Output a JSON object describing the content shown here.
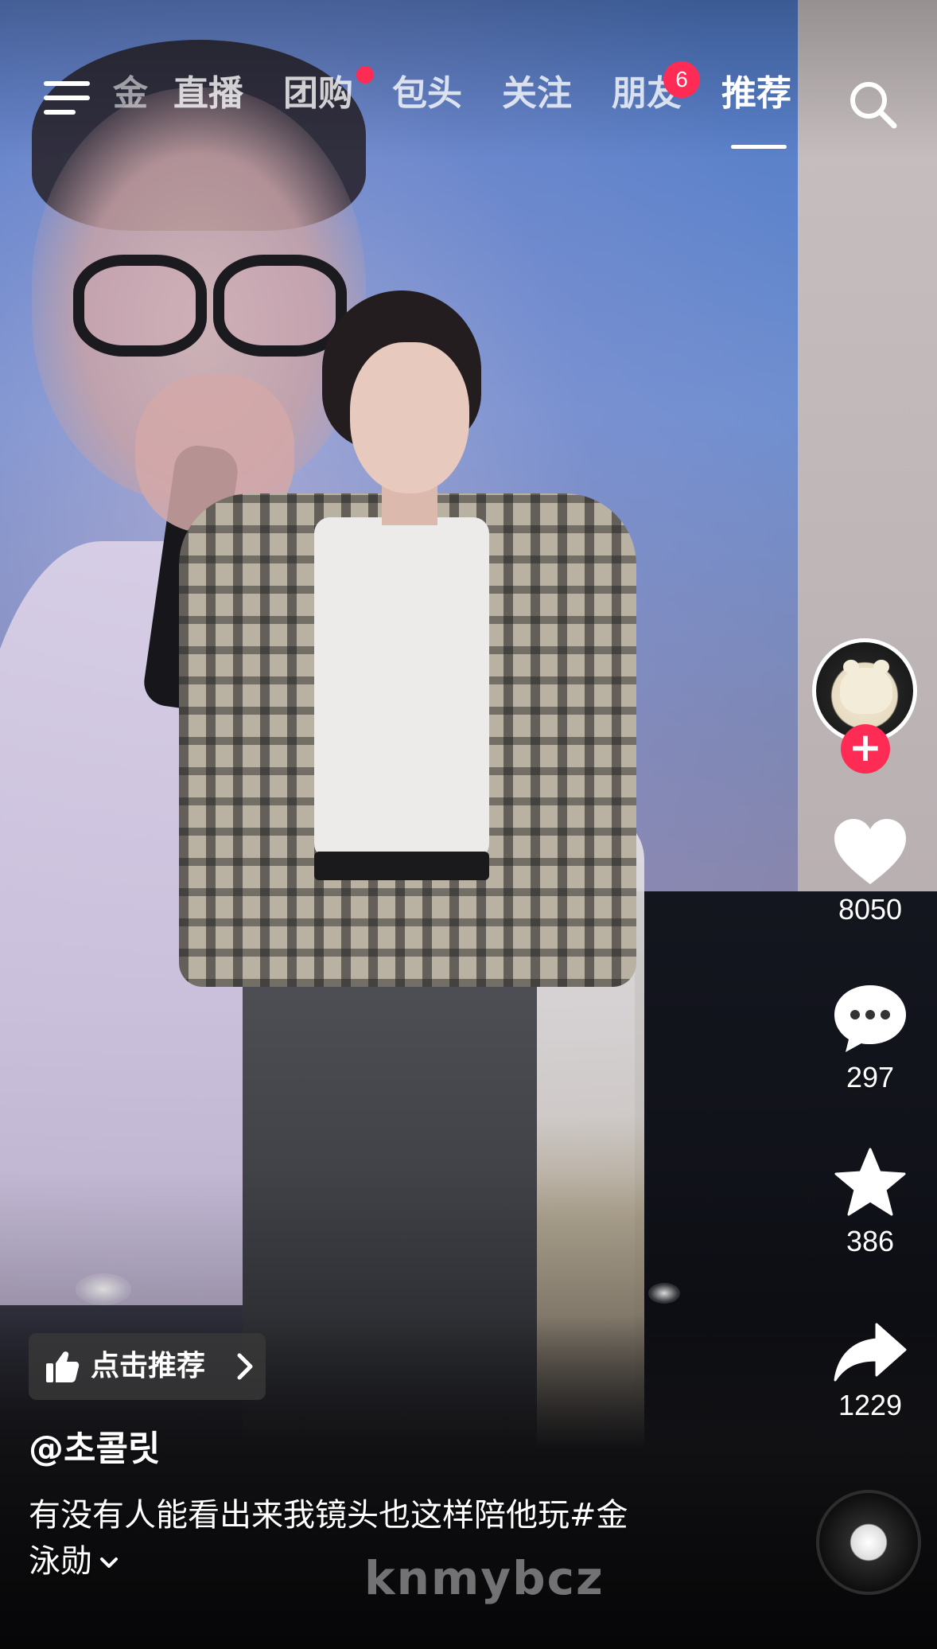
{
  "nav": {
    "partial_tab": "金",
    "tabs": [
      {
        "label": "直播",
        "active": false
      },
      {
        "label": "团购",
        "active": false,
        "dot_badge": true
      },
      {
        "label": "包头",
        "active": false
      },
      {
        "label": "关注",
        "active": false
      },
      {
        "label": "朋友",
        "active": false,
        "badge_count": "6"
      },
      {
        "label": "推荐",
        "active": true
      }
    ],
    "left_icon": "menu-icon",
    "right_icon": "search-icon"
  },
  "actions": {
    "avatar_icon": "bear-avatar",
    "follow_symbol": "+",
    "like_count": "8050",
    "comment_count": "297",
    "favorite_count": "386",
    "share_count": "1229"
  },
  "post": {
    "recommend_label": "点击推荐",
    "author": "@초콜릿",
    "caption_line1": "有没有人能看出来我镜头也这样陪他玩#金",
    "caption_line2": "泳勋",
    "watermark": "knmybcz"
  },
  "colors": {
    "accent": "#fe2c55",
    "text": "#ffffff"
  }
}
